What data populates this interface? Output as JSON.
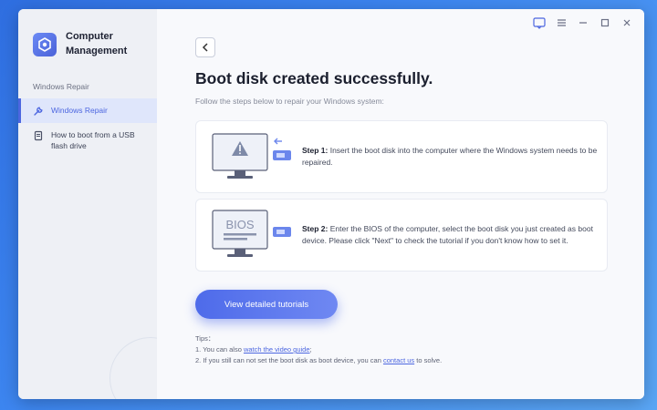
{
  "app": {
    "title": "Computer Management"
  },
  "sidebar": {
    "section_label": "Windows Repair",
    "items": [
      {
        "label": "Windows Repair",
        "icon": "wrench-icon",
        "active": true
      },
      {
        "label": "How to boot from a USB flash drive",
        "icon": "document-icon",
        "active": false
      }
    ]
  },
  "window_controls": [
    "feedback-icon",
    "menu-icon",
    "minimize-icon",
    "maximize-icon",
    "close-icon"
  ],
  "main": {
    "title": "Boot disk created successfully.",
    "subtitle": "Follow the steps below to repair your Windows system:",
    "steps": [
      {
        "label": "Step 1:",
        "text": "Insert the boot disk into the computer where the Windows system needs to be repaired."
      },
      {
        "label": "Step 2:",
        "text": "Enter the BIOS of the computer, select the boot disk you just created as boot device. Please click \"Next\" to check the tutorial if you don't know how to set it.",
        "screen_text": "BIOS"
      }
    ],
    "primary_button": "View detailed tutorials",
    "tips": {
      "heading": "Tips：",
      "line1_prefix": "1. You can also ",
      "line1_link": "watch the video guide",
      "line1_suffix": ";",
      "line2_prefix": "2. If you still can not set the boot disk as boot device, you can ",
      "line2_link": "contact us",
      "line2_suffix": " to solve."
    }
  },
  "colors": {
    "accent": "#4c66e0",
    "background": "#3d86f0"
  }
}
